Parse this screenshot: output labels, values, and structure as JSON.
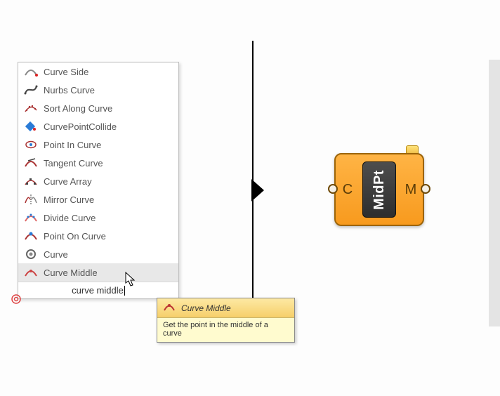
{
  "menu": {
    "items": [
      {
        "label": "Curve Side",
        "icon": "curve-side-icon"
      },
      {
        "label": "Nurbs Curve",
        "icon": "nurbs-curve-icon"
      },
      {
        "label": "Sort Along Curve",
        "icon": "sort-along-curve-icon"
      },
      {
        "label": "CurvePointCollide",
        "icon": "curve-point-collide-icon"
      },
      {
        "label": "Point In Curve",
        "icon": "point-in-curve-icon"
      },
      {
        "label": "Tangent Curve",
        "icon": "tangent-curve-icon"
      },
      {
        "label": "Curve Array",
        "icon": "curve-array-icon"
      },
      {
        "label": "Mirror Curve",
        "icon": "mirror-curve-icon"
      },
      {
        "label": "Divide Curve",
        "icon": "divide-curve-icon"
      },
      {
        "label": "Point On Curve",
        "icon": "point-on-curve-icon"
      },
      {
        "label": "Curve",
        "icon": "curve-icon"
      },
      {
        "label": "Curve Middle",
        "icon": "curve-middle-icon"
      }
    ],
    "search_text": "curve middle",
    "highlighted_index": 11
  },
  "tooltip": {
    "title": "Curve Middle",
    "body": "Get the point in the middle of a curve"
  },
  "node": {
    "name": "MidPt",
    "input_label": "C",
    "output_label": "M"
  },
  "colors": {
    "node_fill": "#f89f26",
    "node_border": "#9c6408",
    "tooltip_bg": "#fffbcf",
    "tooltip_head": "#f9d97f"
  }
}
